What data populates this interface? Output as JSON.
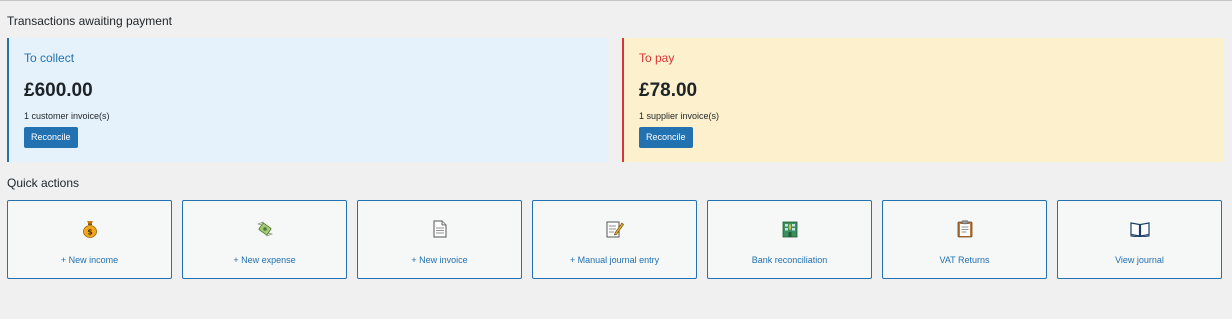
{
  "awaiting": {
    "title": "Transactions awaiting payment",
    "collect": {
      "heading": "To collect",
      "amount": "£600.00",
      "subtext": "1 customer invoice(s)",
      "button_label": "Reconcile",
      "accent": "#2271b1",
      "background": "#e5f2fb"
    },
    "pay": {
      "heading": "To pay",
      "amount": "£78.00",
      "subtext": "1 supplier invoice(s)",
      "button_label": "Reconcile",
      "accent": "#d63638",
      "background": "#fcf0cd"
    }
  },
  "quick_actions": {
    "title": "Quick actions",
    "items": [
      {
        "label": "+ New income",
        "icon": "money-bag-icon"
      },
      {
        "label": "+ New expense",
        "icon": "money-wings-icon"
      },
      {
        "label": "+ New invoice",
        "icon": "document-icon"
      },
      {
        "label": "+ Manual journal entry",
        "icon": "memo-pencil-icon"
      },
      {
        "label": "Bank reconciliation",
        "icon": "bank-building-icon"
      },
      {
        "label": "VAT Returns",
        "icon": "clipboard-icon"
      },
      {
        "label": "View journal",
        "icon": "open-book-icon"
      }
    ]
  }
}
